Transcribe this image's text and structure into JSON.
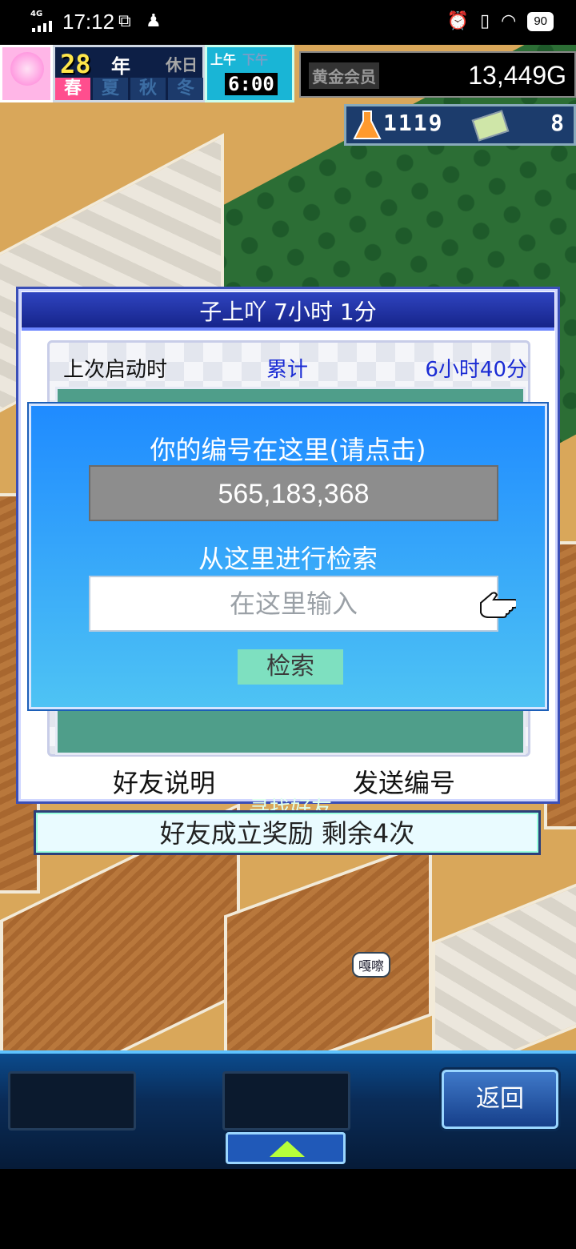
{
  "status_bar": {
    "network": "4G",
    "time": "17:12",
    "battery": "90",
    "icons": [
      "signal-icon",
      "notification-icon",
      "qq-icon",
      "alarm-icon",
      "vibrate-icon",
      "wifi-icon",
      "battery-icon"
    ]
  },
  "hud": {
    "year": "28",
    "year_label": "年",
    "holiday_label": "休日",
    "seasons": [
      "春",
      "夏",
      "秋",
      "冬"
    ],
    "active_season": "春",
    "am_label": "上午",
    "pm_label": "下午",
    "clock": "6:00",
    "member_label": "黄金会员",
    "money": "13,449G",
    "research_points": "1119",
    "tickets": "8"
  },
  "friend_panel": {
    "title": "子上吖  7小时 1分",
    "last_launch_label": "上次启动时",
    "cumulative_label": "累计",
    "cumulative_value": "6小时40分",
    "find_friend_label": "寻找好友",
    "explain_button": "好友说明",
    "send_id_button": "发送编号"
  },
  "id_dialog": {
    "heading": "你的编号在这里(请点击)",
    "player_id": "565,183,368",
    "search_heading": "从这里进行检索",
    "search_placeholder": "在这里输入",
    "search_button": "检索"
  },
  "reward_bar": {
    "text": "好友成立奖励  剩余4次"
  },
  "world": {
    "speech_bubble": "嘎嚓"
  },
  "bottom_bar": {
    "back_button": "返回"
  },
  "colors": {
    "panel_border": "#3b4fb6",
    "dialog_blue": "#1f8bff",
    "accent_text": "#1a2bd4",
    "search_button": "#7ee0c0"
  }
}
